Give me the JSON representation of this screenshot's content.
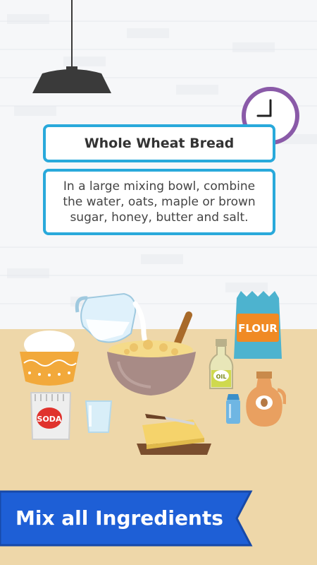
{
  "recipe": {
    "title": "Whole Wheat Bread",
    "instruction": "In a large mixing bowl, combine the water, oats, maple or brown sugar, honey, butter and salt."
  },
  "labels": {
    "flour": "FLOUR",
    "soda": "SODA",
    "oil": "OIL"
  },
  "banner": {
    "text": "Mix all Ingredients"
  },
  "colors": {
    "accent": "#29a9db",
    "banner": "#1e5fd6",
    "counter": "#eed7a9",
    "wall": "#f6f7f9",
    "clock_ring": "#8a5aa8",
    "flour_bag": "#4db3cf"
  }
}
